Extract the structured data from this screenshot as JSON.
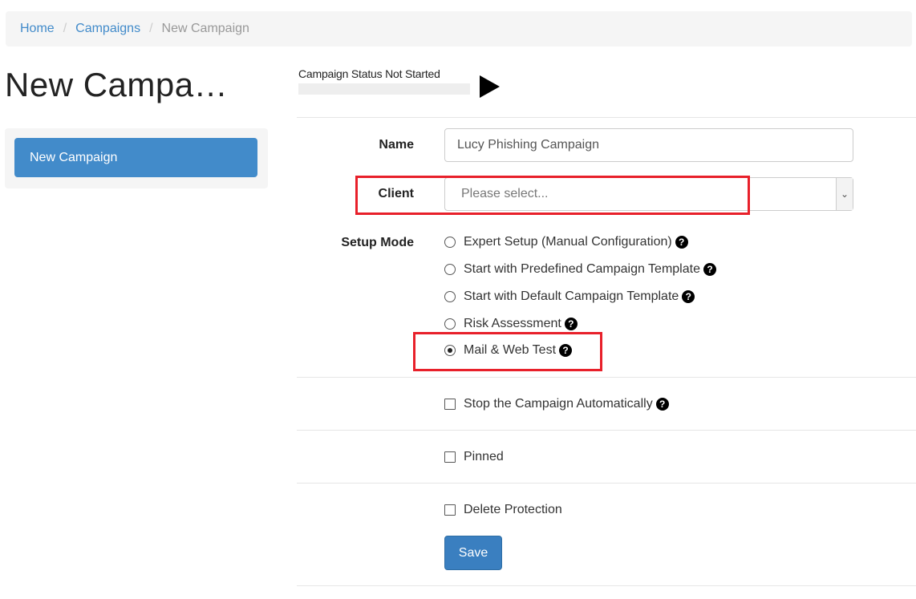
{
  "breadcrumb": {
    "home": "Home",
    "campaigns": "Campaigns",
    "current": "New Campaign",
    "separator": "/"
  },
  "page_title": "New Campa…",
  "sidebar": {
    "active_item": "New Campaign"
  },
  "status": {
    "text": "Campaign Status Not Started",
    "action_icon": "play-icon"
  },
  "form": {
    "name_label": "Name",
    "name_value": "Lucy Phishing Campaign",
    "client_label": "Client",
    "client_placeholder": "Please select...",
    "setup_mode_label": "Setup Mode",
    "setup_options": [
      {
        "label": "Expert Setup (Manual Configuration)",
        "checked": false,
        "help": true
      },
      {
        "label": "Start with Predefined Campaign Template",
        "checked": false,
        "help": true
      },
      {
        "label": "Start with Default Campaign Template",
        "checked": false,
        "help": true
      },
      {
        "label": "Risk Assessment",
        "checked": false,
        "help": true
      },
      {
        "label": "Mail & Web Test",
        "checked": true,
        "help": true
      }
    ],
    "stop_automatically": {
      "label": "Stop the Campaign Automatically",
      "checked": false
    },
    "pinned": {
      "label": "Pinned",
      "checked": false
    },
    "delete_protection": {
      "label": "Delete Protection",
      "checked": false
    },
    "save_label": "Save"
  },
  "colors": {
    "primary": "#428bca",
    "highlight": "#e8202a",
    "breadcrumb_bg": "#f5f5f5"
  }
}
